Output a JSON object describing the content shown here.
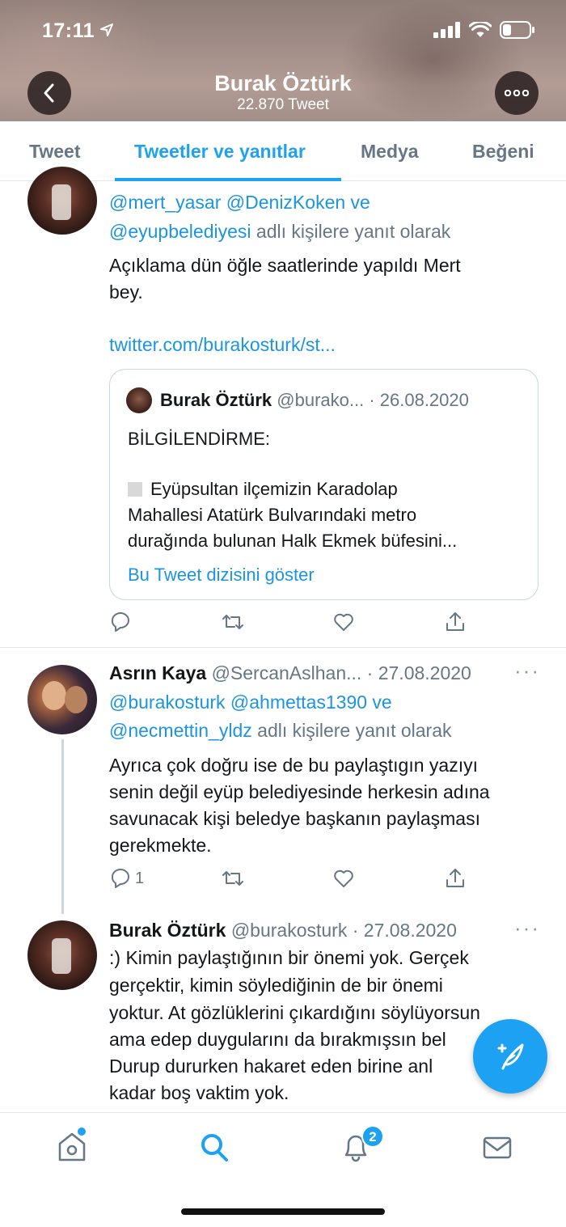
{
  "status_bar": {
    "time": "17:11"
  },
  "header": {
    "title": "Burak Öztürk",
    "subtitle": "22.870 Tweet"
  },
  "tabs": [
    {
      "label": "Tweet"
    },
    {
      "label": "Tweetler ve yanıtlar"
    },
    {
      "label": "Medya"
    },
    {
      "label": "Beğeni"
    }
  ],
  "tweet1": {
    "reply_mention1": "@mert_yasar",
    "reply_mention2": "@DenizKoken",
    "reply_and": "ve",
    "reply_mention3": "@eyupbelediyesi",
    "reply_suffix": "adlı kişilere yanıt olarak",
    "text_line1": "Açıklama dün öğle saatlerinde yapıldı Mert",
    "text_line2": "bey.",
    "link": "twitter.com/burakosturk/st...",
    "quote": {
      "name": "Burak Öztürk",
      "handle_date": "@burako... · 26.08.2020",
      "line1": "BİLGİLENDİRME:",
      "line2": "Eyüpsultan ilçemizin Karadolap",
      "line3": "Mahallesi Atatürk Bulvarındaki metro",
      "line4": "durağında bulunan Halk Ekmek büfesini...",
      "thread_link": "Bu Tweet dizisini göster"
    }
  },
  "tweet2": {
    "name": "Asrın Kaya",
    "handle_date": "@SercanAslhan... · 27.08.2020",
    "reply_mention1": "@burakosturk",
    "reply_mention2": "@ahmettas1390",
    "reply_and": "ve",
    "reply_mention3": "@necmettin_yldz",
    "reply_suffix": "adlı kişilere yanıt olarak",
    "text_line1": "Ayrıca çok doğru ise de bu paylaştıgın yazıyı",
    "text_line2": "senin değil eyüp belediyesinde herkesin adına",
    "text_line3": "savunacak kişi beledye başkanın paylaşması",
    "text_line4": "gerekmekte.",
    "reply_count": "1"
  },
  "tweet3": {
    "name": "Burak Öztürk",
    "handle_date": "@burakosturk · 27.08.2020",
    "text_line1": ":) Kimin paylaştığının bir önemi yok. Gerçek",
    "text_line2": "gerçektir, kimin söylediğinin de bir önemi",
    "text_line3": "yoktur. At gözlüklerini çıkardığını söylüyorsun",
    "text_line4": "ama edep duygularını da bırakmışsın bel",
    "text_line5": "Durup dururken hakaret eden birine anl",
    "text_line6": "kadar boş vaktim yok."
  },
  "more_glyph": "···",
  "bottom_nav": {
    "notifications_badge": "2"
  },
  "colors": {
    "accent": "#1da1f2",
    "link": "#1b95e0",
    "muted": "#657786"
  }
}
